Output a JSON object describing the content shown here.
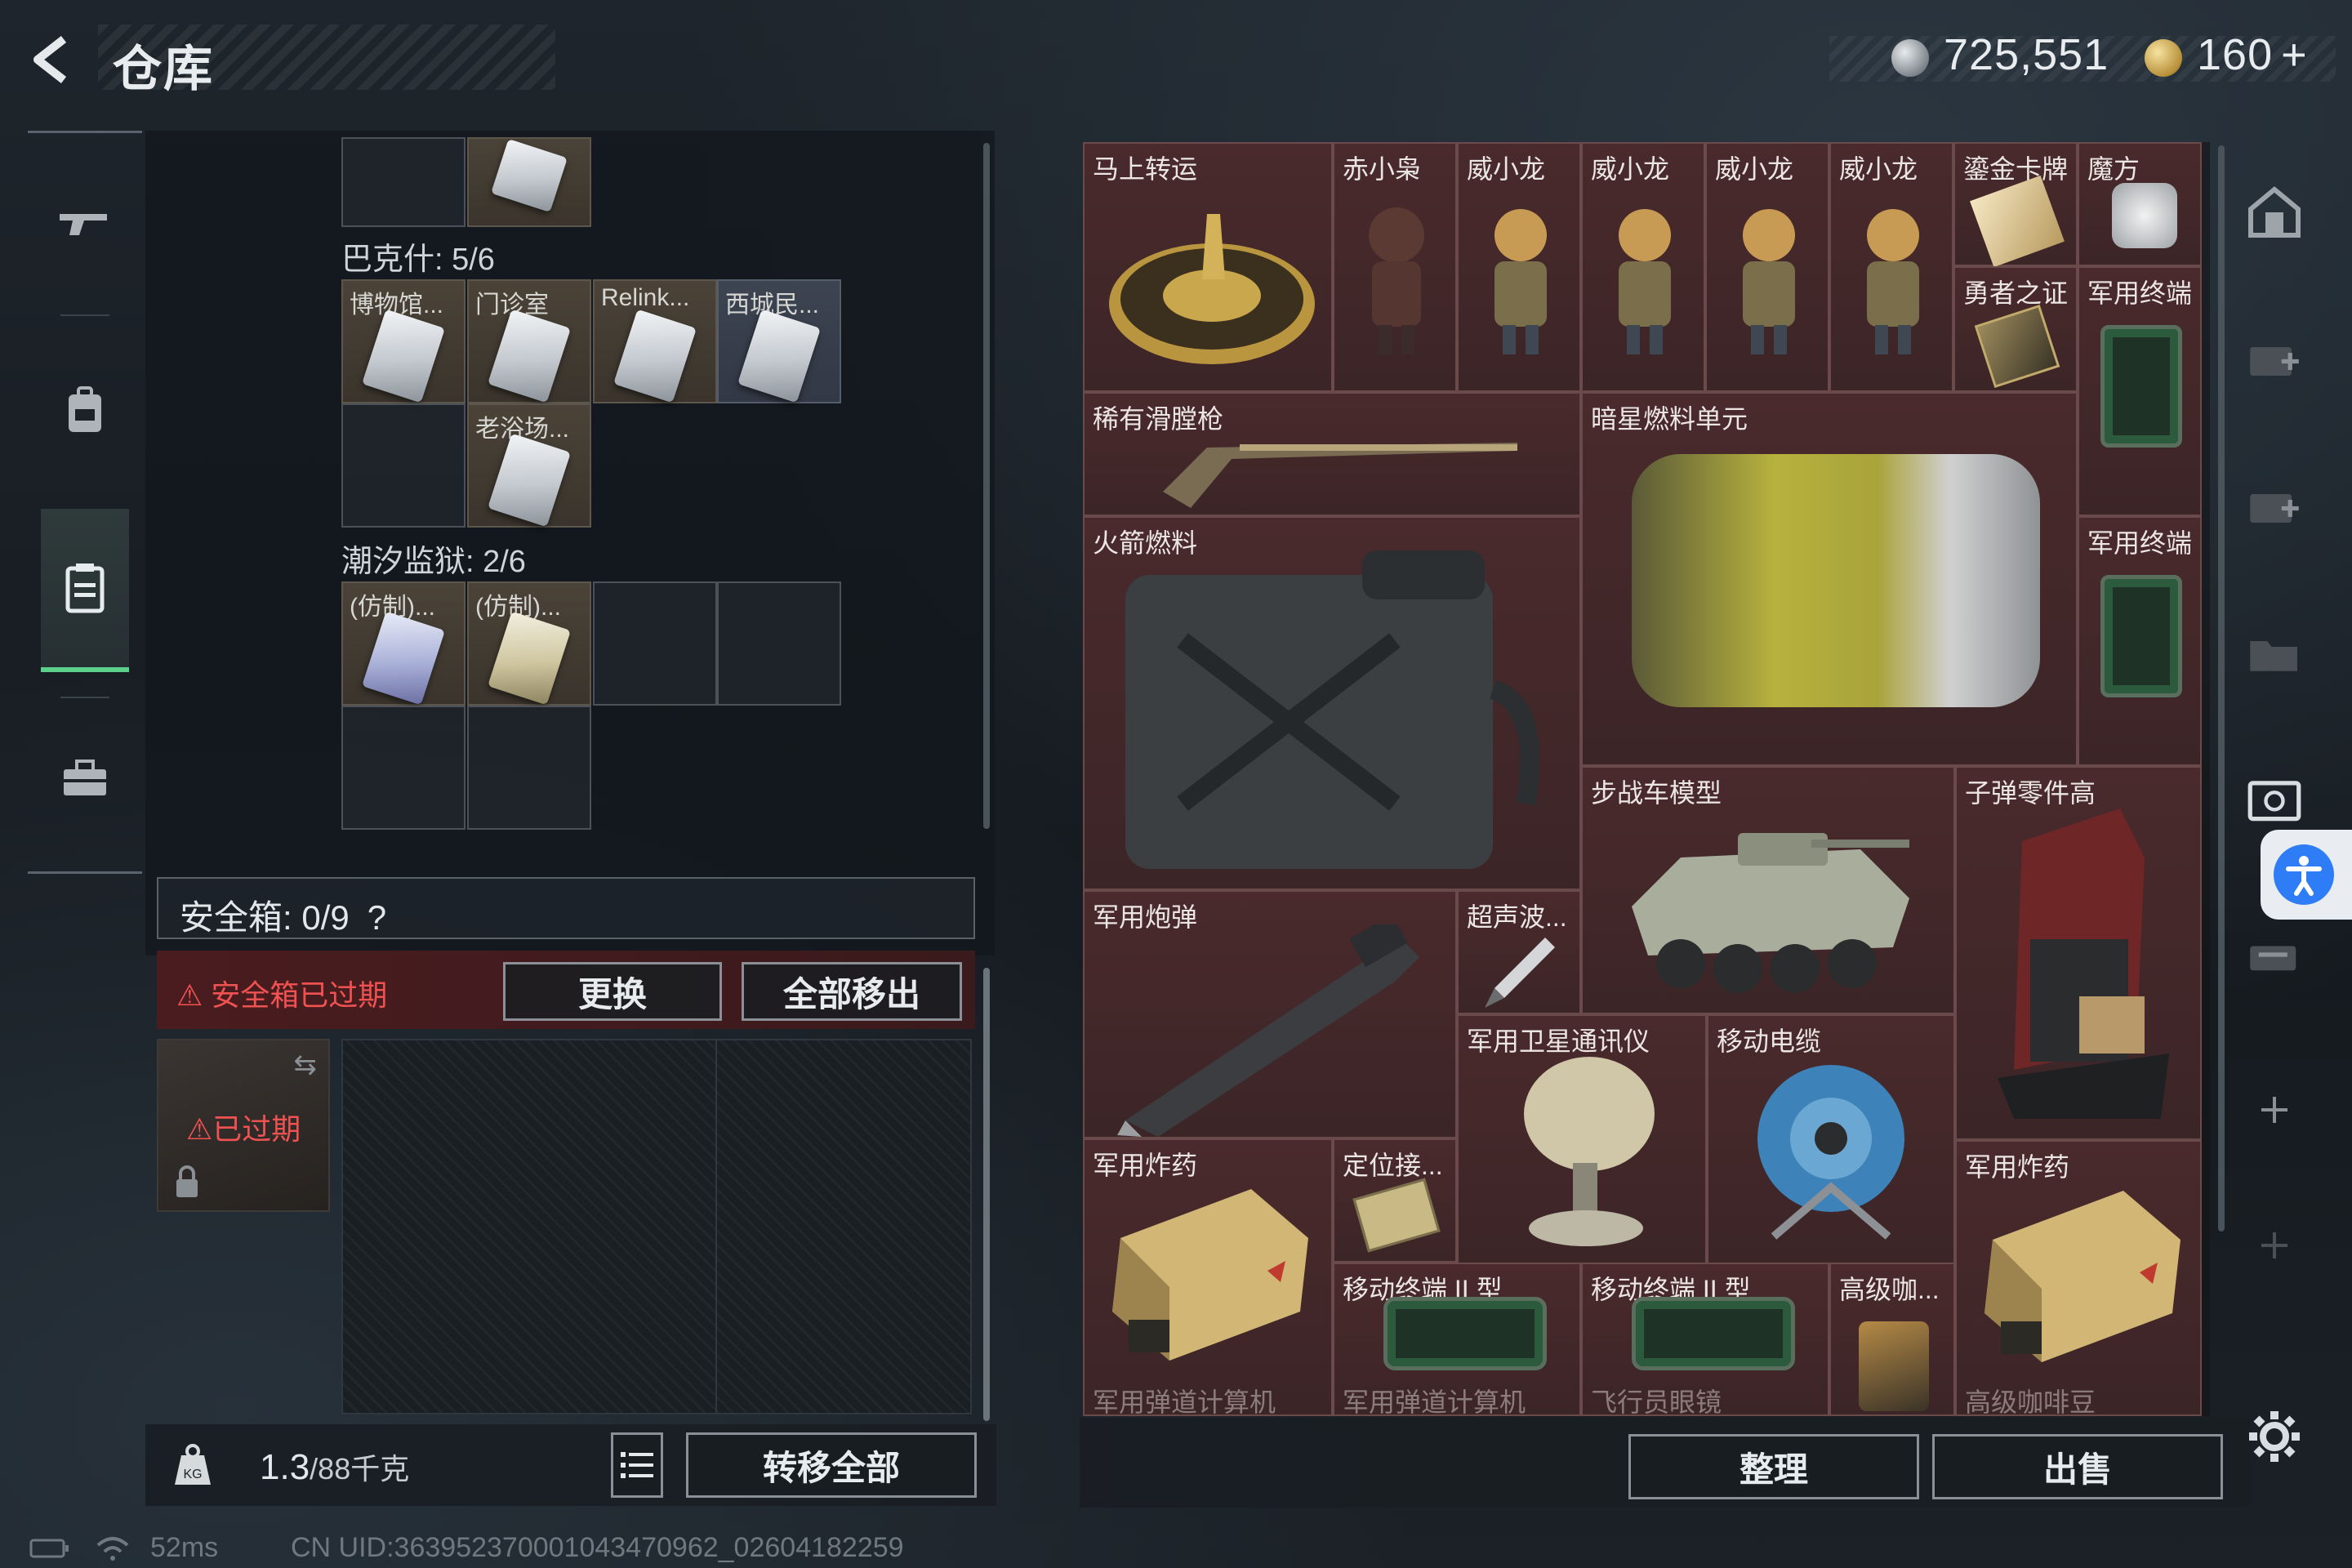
{
  "header": {
    "title": "仓库",
    "silver_amount": "725,551",
    "gold_amount": "160",
    "gold_plus": "+"
  },
  "left_panel": {
    "section_bakesh": "巴克什: 5/6",
    "bakesh_items": [
      "博物馆...",
      "门诊室",
      "Relink...",
      "西城民...",
      "老浴场..."
    ],
    "section_tide": "潮汐监狱: 2/6",
    "tide_items": [
      "(仿制)...",
      "(仿制)..."
    ],
    "safebox_label": "安全箱: 0/9",
    "safebox_help": "?",
    "expired_warning": "安全箱已过期",
    "replace_button": "更换",
    "remove_all_button": "全部移出",
    "thumb_expired": "已过期",
    "weight_value": "1.3",
    "weight_capacity": "/88千克",
    "transfer_all_button": "转移全部"
  },
  "right_panel": {
    "items": [
      "马上转运",
      "赤小枭",
      "威小龙",
      "威小龙",
      "威小龙",
      "威小龙",
      "鎏金卡牌",
      "魔方",
      "勇者之证",
      "军用终端",
      "稀有滑膛枪",
      "暗星燃料单元",
      "火箭燃料",
      "军用终端",
      "步战车模型",
      "子弹零件高",
      "军用炮弹",
      "超声波...",
      "军用卫星通讯仪",
      "移动电缆",
      "军用炸药",
      "定位接...",
      "移动终端 II 型",
      "移动终端 II 型",
      "高级咖...",
      "军用炸药"
    ],
    "cut_labels": [
      "军用弹道计算机",
      "军用弹道计算机",
      "飞行员眼镜",
      "高级咖啡豆"
    ],
    "sort_button": "整理",
    "sell_button": "出售"
  },
  "status_bar": {
    "ping": "52ms",
    "uid": "CN UID:363952370001043470962_02604182259"
  },
  "colors": {
    "accent_green": "#5ad08a",
    "warning_red": "#f05252",
    "item_bg": "#4a2a2c"
  }
}
